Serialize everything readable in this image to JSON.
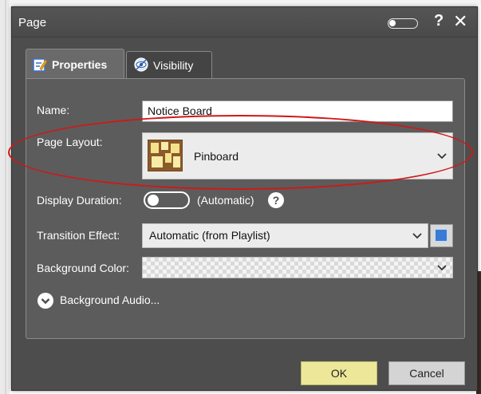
{
  "window": {
    "title": "Page",
    "help_label": "?",
    "close_label": "✕"
  },
  "tabs": [
    {
      "label": "Properties",
      "active": true,
      "icon": "edit-page-icon"
    },
    {
      "label": "Visibility",
      "active": false,
      "icon": "eye-icon"
    }
  ],
  "form": {
    "name": {
      "label": "Name:",
      "value": "Notice Board"
    },
    "page_layout": {
      "label": "Page Layout:",
      "value": "Pinboard",
      "icon": "pinboard-layout-icon"
    },
    "display_duration": {
      "label": "Display Duration:",
      "toggle_on": false,
      "value_text": "(Automatic)"
    },
    "transition_effect": {
      "label": "Transition Effect:",
      "value": "Automatic (from Playlist)"
    },
    "background_color": {
      "label": "Background Color:",
      "value": ""
    },
    "background_audio": {
      "label": "Background Audio..."
    }
  },
  "buttons": {
    "ok": "OK",
    "cancel": "Cancel"
  },
  "colors": {
    "dialog_bg": "#4d4d4d",
    "panel_bg": "#5c5c5c",
    "ok_bg": "#ede79a",
    "annotation_red": "#d01818",
    "transition_color_swatch": "#3a7bd5"
  }
}
